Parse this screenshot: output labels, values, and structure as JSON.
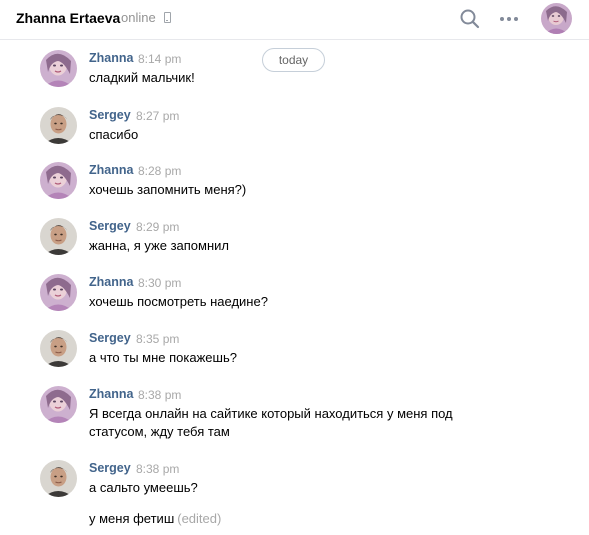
{
  "header": {
    "contact_name": "Zhanna Ertaeva",
    "status": "online"
  },
  "icons": {
    "phone": "mobile-phone-icon",
    "search": "search-icon",
    "more": "more-dots-icon"
  },
  "date_divider": "today",
  "messages": [
    {
      "author": "Zhanna",
      "time": "8:14 pm",
      "text": "сладкий мальчик!"
    },
    {
      "author": "Sergey",
      "time": "8:27 pm",
      "text": "спасибо"
    },
    {
      "author": "Zhanna",
      "time": "8:28 pm",
      "text": "хочешь запомнить меня?)"
    },
    {
      "author": "Sergey",
      "time": "8:29 pm",
      "text": "жанна, я уже запомнил"
    },
    {
      "author": "Zhanna",
      "time": "8:30 pm",
      "text": "хочешь посмотреть наедине?"
    },
    {
      "author": "Sergey",
      "time": "8:35 pm",
      "text": "а что ты мне покажешь?"
    },
    {
      "author": "Zhanna",
      "time": "8:38 pm",
      "text": "Я всегда онлайн на сайтике который находиться у меня под статусом, жду тебя там"
    },
    {
      "author": "Sergey",
      "time": "8:38 pm",
      "text": "а сальто умеешь?"
    }
  ],
  "followup": {
    "text": "у меня фетиш",
    "edited_label": "(edited)"
  },
  "colors": {
    "author": "#42648b",
    "muted": "#a8a8a8",
    "divider": "#e7e8ec"
  }
}
